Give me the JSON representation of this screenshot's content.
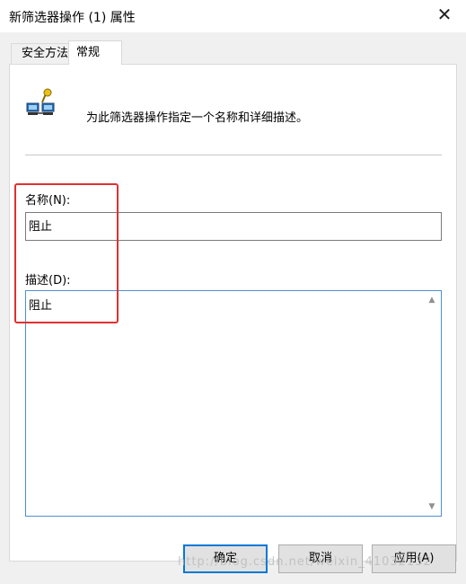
{
  "window": {
    "title": "新筛选器操作 (1) 属性",
    "close_glyph": "✕"
  },
  "tabs": [
    {
      "label": "安全方法",
      "active": false
    },
    {
      "label": "常规",
      "active": true
    }
  ],
  "general": {
    "description": "为此筛选器操作指定一个名称和详细描述。",
    "icon": "network-computers-key-icon",
    "name_label": "名称(N):",
    "name_value": "阻止",
    "desc_label": "描述(D):",
    "desc_value": "阻止"
  },
  "buttons": {
    "ok": "确定",
    "cancel": "取消",
    "apply": "应用(A)"
  },
  "watermark": "http://blog.csdn.net/weixin_41032132",
  "colors": {
    "highlight_box": "#e03030",
    "focus_border": "#0078d7"
  }
}
